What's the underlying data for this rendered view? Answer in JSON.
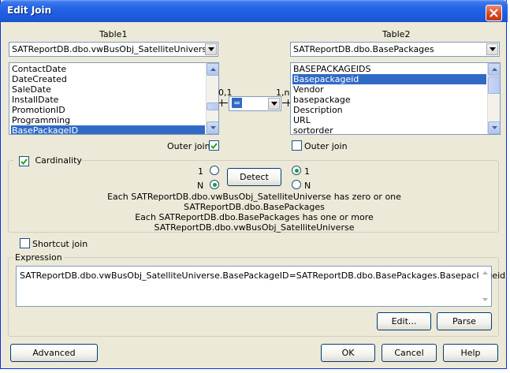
{
  "window": {
    "title": "Edit Join"
  },
  "table1": {
    "heading": "Table1",
    "selected_table": "SATReportDB.dbo.vwBusObj_SatelliteUniverse",
    "columns": [
      "ContactDate",
      "DateCreated",
      "SaleDate",
      "InstallDate",
      "PromotionID",
      "Programming",
      "BasePackageID"
    ],
    "selected_column": "BasePackageID",
    "outer_join_label": "Outer join",
    "outer_join_checked": true
  },
  "table2": {
    "heading": "Table2",
    "selected_table": "SATReportDB.dbo.BasePackages",
    "columns": [
      "BASEPACKAGEIDS",
      "Basepackageid",
      "Vendor",
      "basepackage",
      "Description",
      "URL",
      "sortorder"
    ],
    "selected_column": "Basepackageid",
    "outer_join_label": "Outer join",
    "outer_join_checked": false
  },
  "operator": {
    "left_cardinality": "0,1",
    "right_cardinality": "1,n",
    "value": "="
  },
  "cardinality": {
    "label": "Cardinality",
    "checked": true,
    "left_one": "1",
    "left_n": "N",
    "right_one": "1",
    "right_n": "N",
    "left_selected": "N",
    "right_selected": "1",
    "detect_label": "Detect",
    "desc_line1": "Each SATReportDB.dbo.vwBusObj_SatelliteUniverse has zero or one",
    "desc_line2": "SATReportDB.dbo.BasePackages",
    "desc_line3": "Each SATReportDB.dbo.BasePackages has one or more",
    "desc_line4": "SATReportDB.dbo.vwBusObj_SatelliteUniverse"
  },
  "shortcut": {
    "label": "Shortcut join",
    "checked": false
  },
  "expression": {
    "label": "Expression",
    "text": "SATReportDB.dbo.vwBusObj_SatelliteUniverse.BasePackageID=SATReportDB.dbo.BasePackages.Basepackageid",
    "edit_label": "Edit...",
    "parse_label": "Parse"
  },
  "footer": {
    "advanced_label": "Advanced",
    "ok_label": "OK",
    "cancel_label": "Cancel",
    "help_label": "Help"
  },
  "colors": {
    "title_bar": "#1f5ee3",
    "selection": "#316ac5",
    "dialog_bg": "#ece9d8",
    "radio_dot": "#1b9d27"
  }
}
